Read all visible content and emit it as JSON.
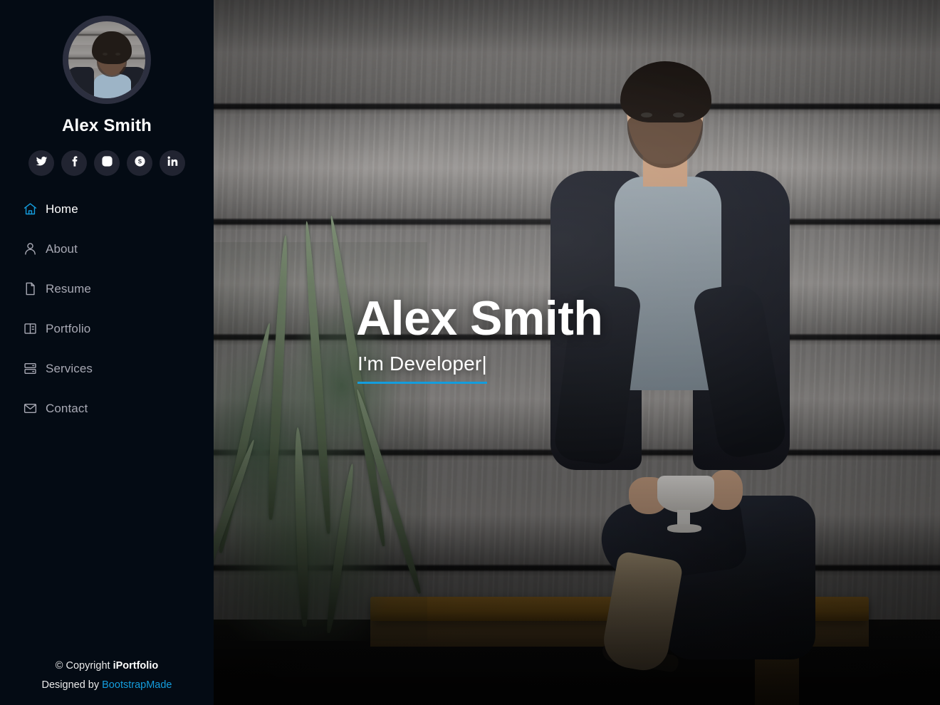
{
  "sidebar": {
    "avatar_alt": "Alex Smith profile photo",
    "name": "Alex Smith",
    "socials": [
      {
        "name": "twitter",
        "label": "Twitter"
      },
      {
        "name": "facebook",
        "label": "Facebook"
      },
      {
        "name": "instagram",
        "label": "Instagram"
      },
      {
        "name": "skype",
        "label": "Skype"
      },
      {
        "name": "linkedin",
        "label": "LinkedIn"
      }
    ],
    "nav": [
      {
        "label": "Home",
        "icon": "home-icon",
        "active": true
      },
      {
        "label": "About",
        "icon": "person-icon",
        "active": false
      },
      {
        "label": "Resume",
        "icon": "file-icon",
        "active": false
      },
      {
        "label": "Portfolio",
        "icon": "columns-icon",
        "active": false
      },
      {
        "label": "Services",
        "icon": "server-icon",
        "active": false
      },
      {
        "label": "Contact",
        "icon": "envelope-icon",
        "active": false
      }
    ],
    "footer": {
      "copyright_prefix": "© Copyright ",
      "copyright_brand": "iPortfolio",
      "credits_prefix": "Designed by ",
      "credits_link": "BootstrapMade"
    }
  },
  "hero": {
    "title": "Alex Smith",
    "subtitle": "I'm Developer|"
  },
  "colors": {
    "sidebar_bg": "#040b14",
    "accent": "#149ddd",
    "nav_inactive": "#a8a9b4",
    "nav_active": "#ffffff",
    "social_bg": "#212431"
  }
}
